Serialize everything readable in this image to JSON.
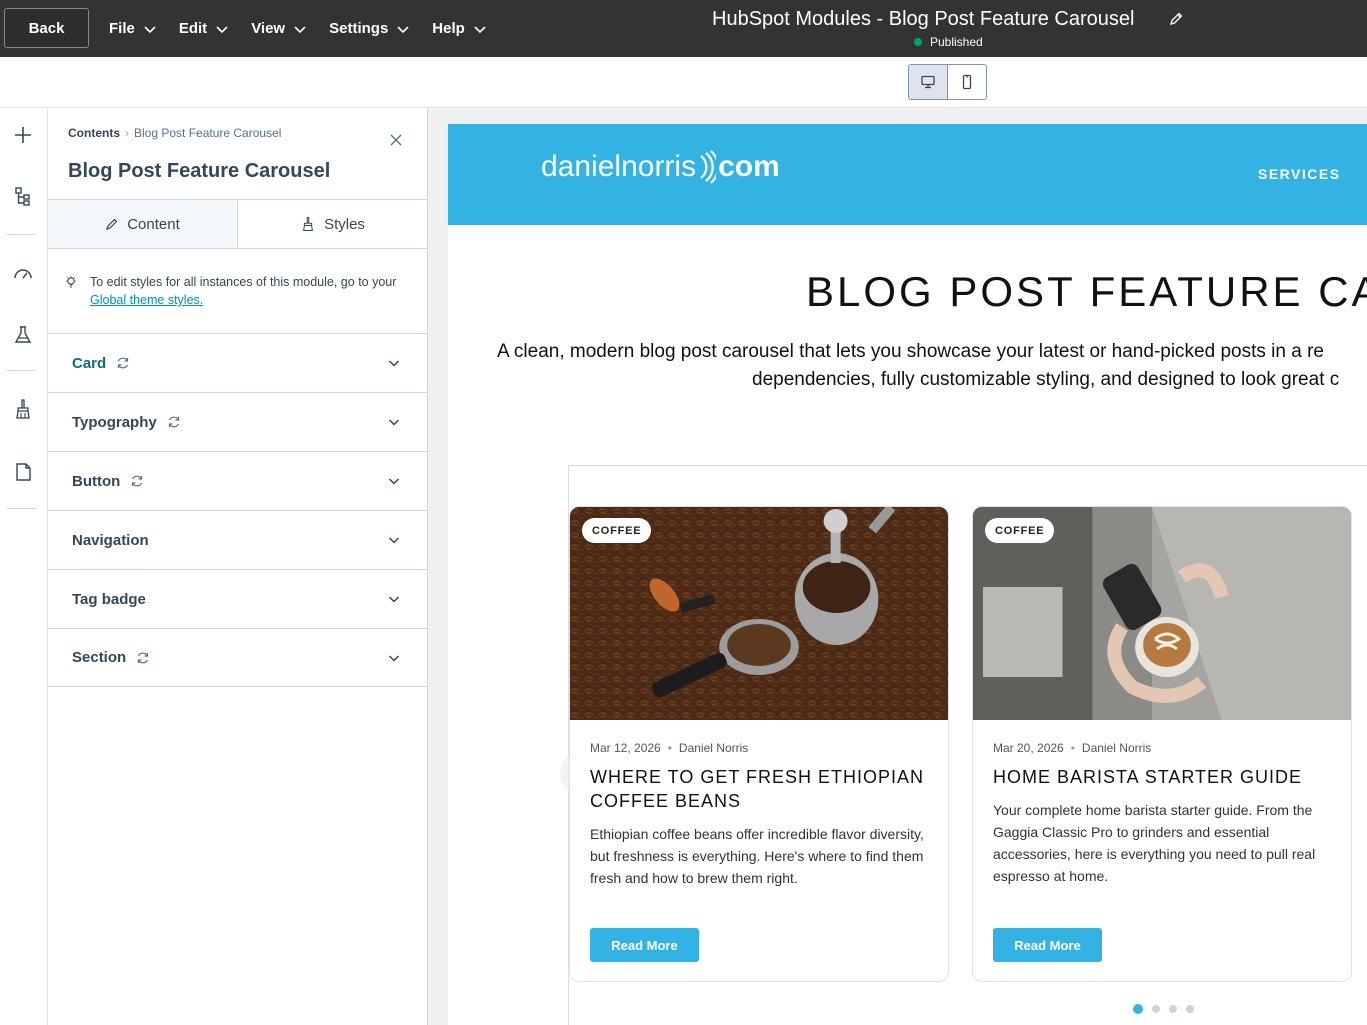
{
  "topbar": {
    "back_label": "Back",
    "menus": [
      "File",
      "Edit",
      "View",
      "Settings",
      "Help"
    ],
    "title": "HubSpot Modules - Blog Post Feature Carousel",
    "status": "Published",
    "status_color": "#00a65a"
  },
  "device_toggle": {
    "options": [
      "desktop-icon",
      "mobile-icon"
    ],
    "active": "desktop"
  },
  "rail": {
    "icons": [
      "plus-icon",
      "layers-tree-icon",
      "speed-gauge-icon",
      "flask-icon",
      "brush-icon",
      "page-icon"
    ]
  },
  "panel": {
    "breadcrumb_root": "Contents",
    "breadcrumb_current": "Blog Post Feature Carousel",
    "title": "Blog Post Feature Carousel",
    "tabs": {
      "content": "Content",
      "styles": "Styles",
      "active": "Styles"
    },
    "hint_text": "To edit styles for all instances of this module, go to your",
    "hint_link": "Global theme styles.",
    "sections": [
      {
        "label": "Card",
        "reset": true
      },
      {
        "label": "Typography",
        "reset": true
      },
      {
        "label": "Button",
        "reset": true
      },
      {
        "label": "Navigation",
        "reset": false
      },
      {
        "label": "Tag badge",
        "reset": false
      },
      {
        "label": "Section",
        "reset": true
      }
    ]
  },
  "preview": {
    "brand_color": "#33b3e3",
    "logo_left": "danielnorris",
    "logo_right": "com",
    "nav_item": "SERVICES",
    "hero_title": "BLOG POST FEATURE CAR",
    "hero_line1": "A clean, modern blog post carousel that lets you showcase your latest or hand-picked posts in a re",
    "hero_line2": "dependencies, fully customizable styling, and designed to look great c",
    "cards": [
      {
        "tag": "COFFEE",
        "date": "Mar 12, 2026",
        "author": "Daniel Norris",
        "title": "WHERE TO GET FRESH ETHIOPIAN COFFEE BEANS",
        "excerpt": "Ethiopian coffee beans offer incredible flavor diversity, but freshness is everything. Here's where to find them fresh and how to brew them right.",
        "button": "Read More"
      },
      {
        "tag": "COFFEE",
        "date": "Mar 20, 2026",
        "author": "Daniel Norris",
        "title": "HOME BARISTA STARTER GUIDE",
        "excerpt": "Your complete home barista starter guide. From the Gaggia Classic Pro to grinders and essential accessories, here is everything you need to pull real espresso at home.",
        "button": "Read More"
      }
    ],
    "pagination": {
      "count": 4,
      "active": 1
    }
  }
}
